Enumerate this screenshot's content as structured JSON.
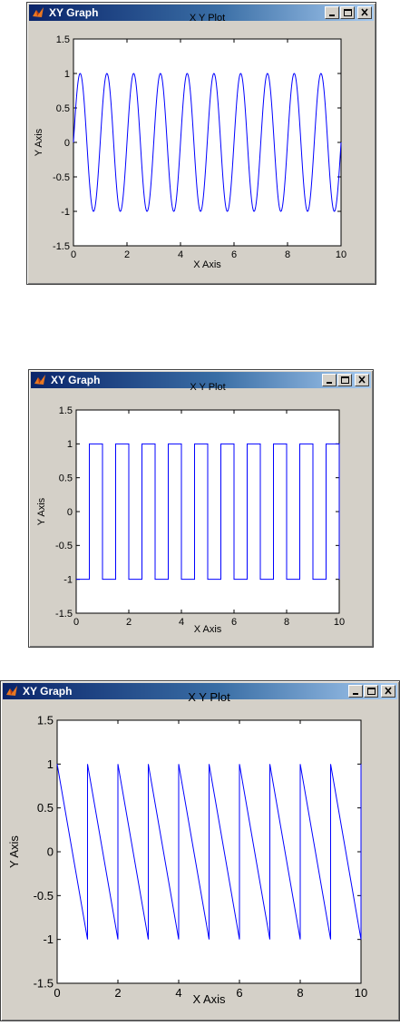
{
  "windows": [
    {
      "title": "XY Graph",
      "plot_title": "X Y Plot",
      "xlabel": "X Axis",
      "ylabel": "Y Axis",
      "buttons": {
        "minimize": "minimize",
        "maximize": "maximize",
        "close": "close"
      }
    },
    {
      "title": "XY Graph",
      "plot_title": "X Y Plot",
      "xlabel": "X Axis",
      "ylabel": "Y Axis",
      "buttons": {
        "minimize": "minimize",
        "maximize": "maximize",
        "close": "close"
      }
    },
    {
      "title": "XY Graph",
      "plot_title": "X Y Plot",
      "xlabel": "X Axis",
      "ylabel": "Y Axis",
      "buttons": {
        "minimize": "minimize",
        "maximize": "maximize",
        "close": "close"
      }
    }
  ],
  "chart_data": [
    {
      "type": "line",
      "title": "X Y Plot",
      "xlabel": "X Axis",
      "ylabel": "Y Axis",
      "xlim": [
        0,
        10
      ],
      "ylim": [
        -1.5,
        1.5
      ],
      "x_ticks": [
        "0",
        "2",
        "4",
        "6",
        "8",
        "10"
      ],
      "y_ticks": [
        "-1.5",
        "-1",
        "-0.5",
        "0",
        "0.5",
        "1",
        "1.5"
      ],
      "grid": false,
      "series": [
        {
          "waveform": "sine",
          "period": 1,
          "amplitude": 1,
          "phase_start": 0,
          "color": "#0000ff"
        }
      ]
    },
    {
      "type": "line",
      "title": "X Y Plot",
      "xlabel": "X Axis",
      "ylabel": "Y Axis",
      "xlim": [
        0,
        10
      ],
      "ylim": [
        -1.5,
        1.5
      ],
      "x_ticks": [
        "0",
        "2",
        "4",
        "6",
        "8",
        "10"
      ],
      "y_ticks": [
        "-1.5",
        "-1",
        "-0.5",
        "0",
        "0.5",
        "1",
        "1.5"
      ],
      "grid": false,
      "series": [
        {
          "waveform": "square",
          "period": 1,
          "low": -1,
          "high": 1,
          "low_fraction": 0.5,
          "color": "#0000ff"
        }
      ]
    },
    {
      "type": "line",
      "title": "X Y Plot",
      "xlabel": "X Axis",
      "ylabel": "Y Axis",
      "xlim": [
        0,
        10
      ],
      "ylim": [
        -1.5,
        1.5
      ],
      "x_ticks": [
        "0",
        "2",
        "4",
        "6",
        "8",
        "10"
      ],
      "y_ticks": [
        "-1.5",
        "-1",
        "-0.5",
        "0",
        "0.5",
        "1",
        "1.5"
      ],
      "grid": false,
      "series": [
        {
          "waveform": "sawtooth-down",
          "period": 1,
          "start": 1,
          "end": -1,
          "color": "#0000ff"
        }
      ]
    }
  ]
}
